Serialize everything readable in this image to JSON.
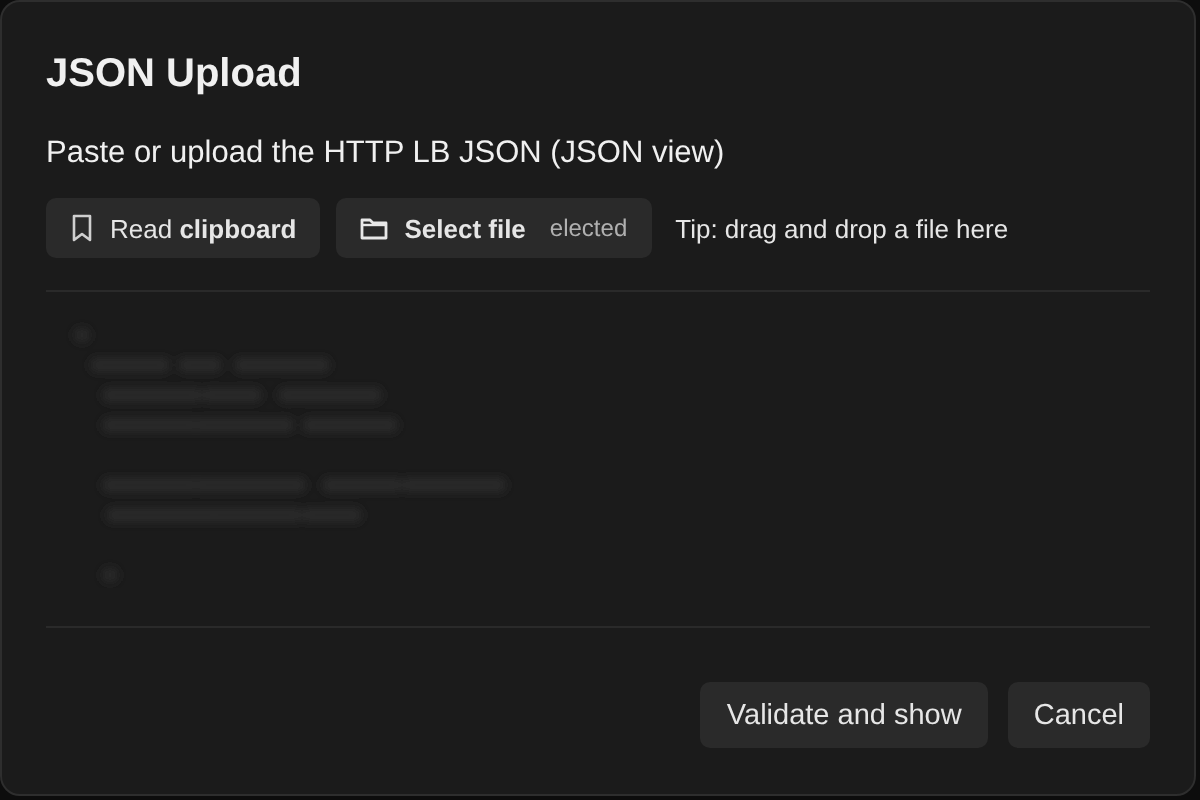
{
  "dialog": {
    "title": "JSON Upload",
    "subtitle": "Paste or upload the HTTP LB JSON (JSON view)"
  },
  "toolbar": {
    "read_clipboard": "Read **clipboard**",
    "select_file": "Select file",
    "file_status": "elected",
    "tip": "Tip: drag and drop a file here"
  },
  "buttons": [
    {
      "label": "Validate and show"
    },
    {
      "label": "Cancel"
    }
  ]
}
